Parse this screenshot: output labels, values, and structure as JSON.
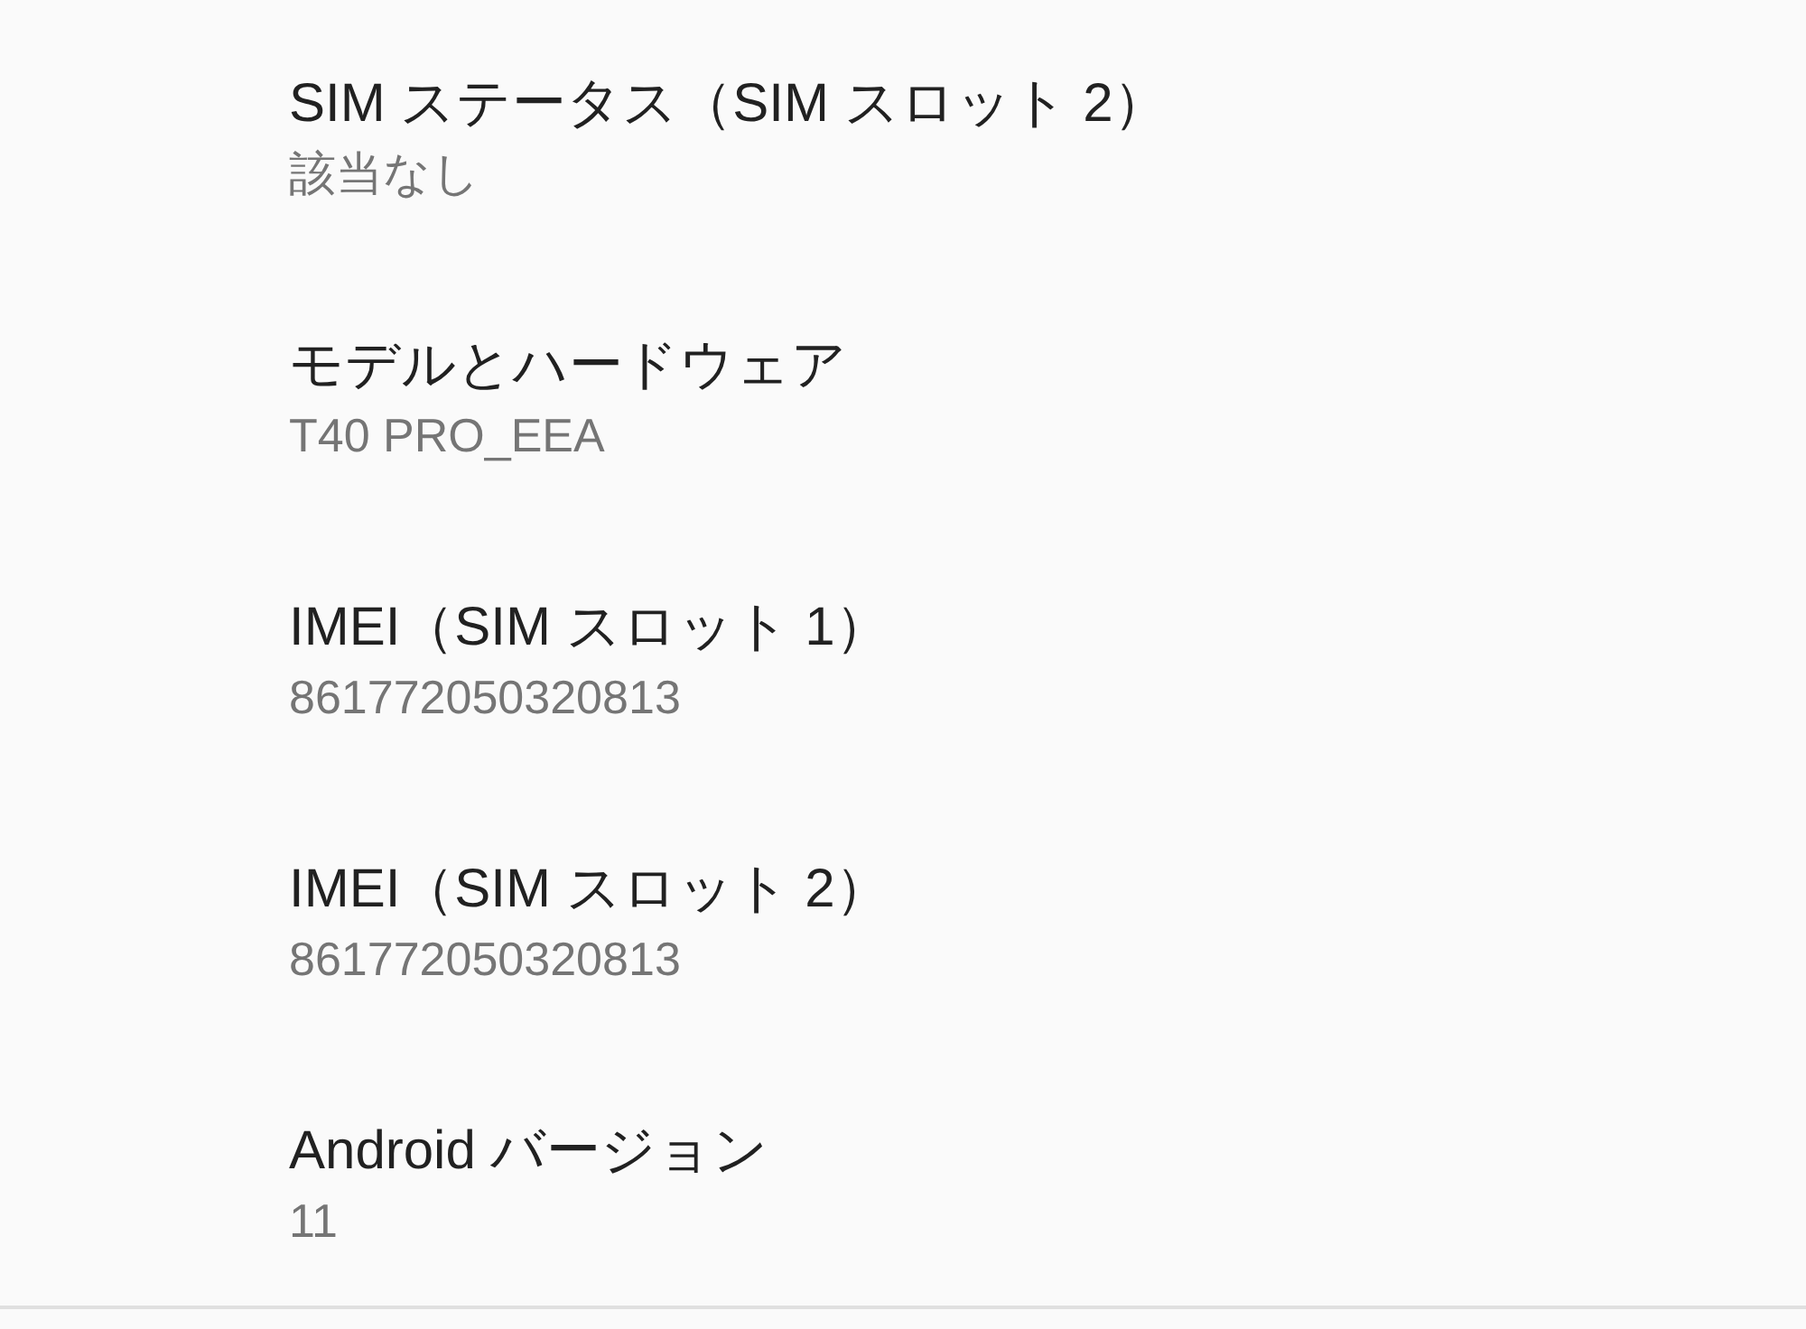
{
  "items": [
    {
      "title": "SIM ステータス（SIM スロット 2）",
      "summary": "該当なし"
    },
    {
      "title": "モデルとハードウェア",
      "summary": "T40 PRO_EEA"
    },
    {
      "title": "IMEI（SIM スロット 1）",
      "summary": "861772050320813"
    },
    {
      "title": "IMEI（SIM スロット 2）",
      "summary": "861772050320813"
    },
    {
      "title": "Android バージョン",
      "summary": "11"
    }
  ]
}
